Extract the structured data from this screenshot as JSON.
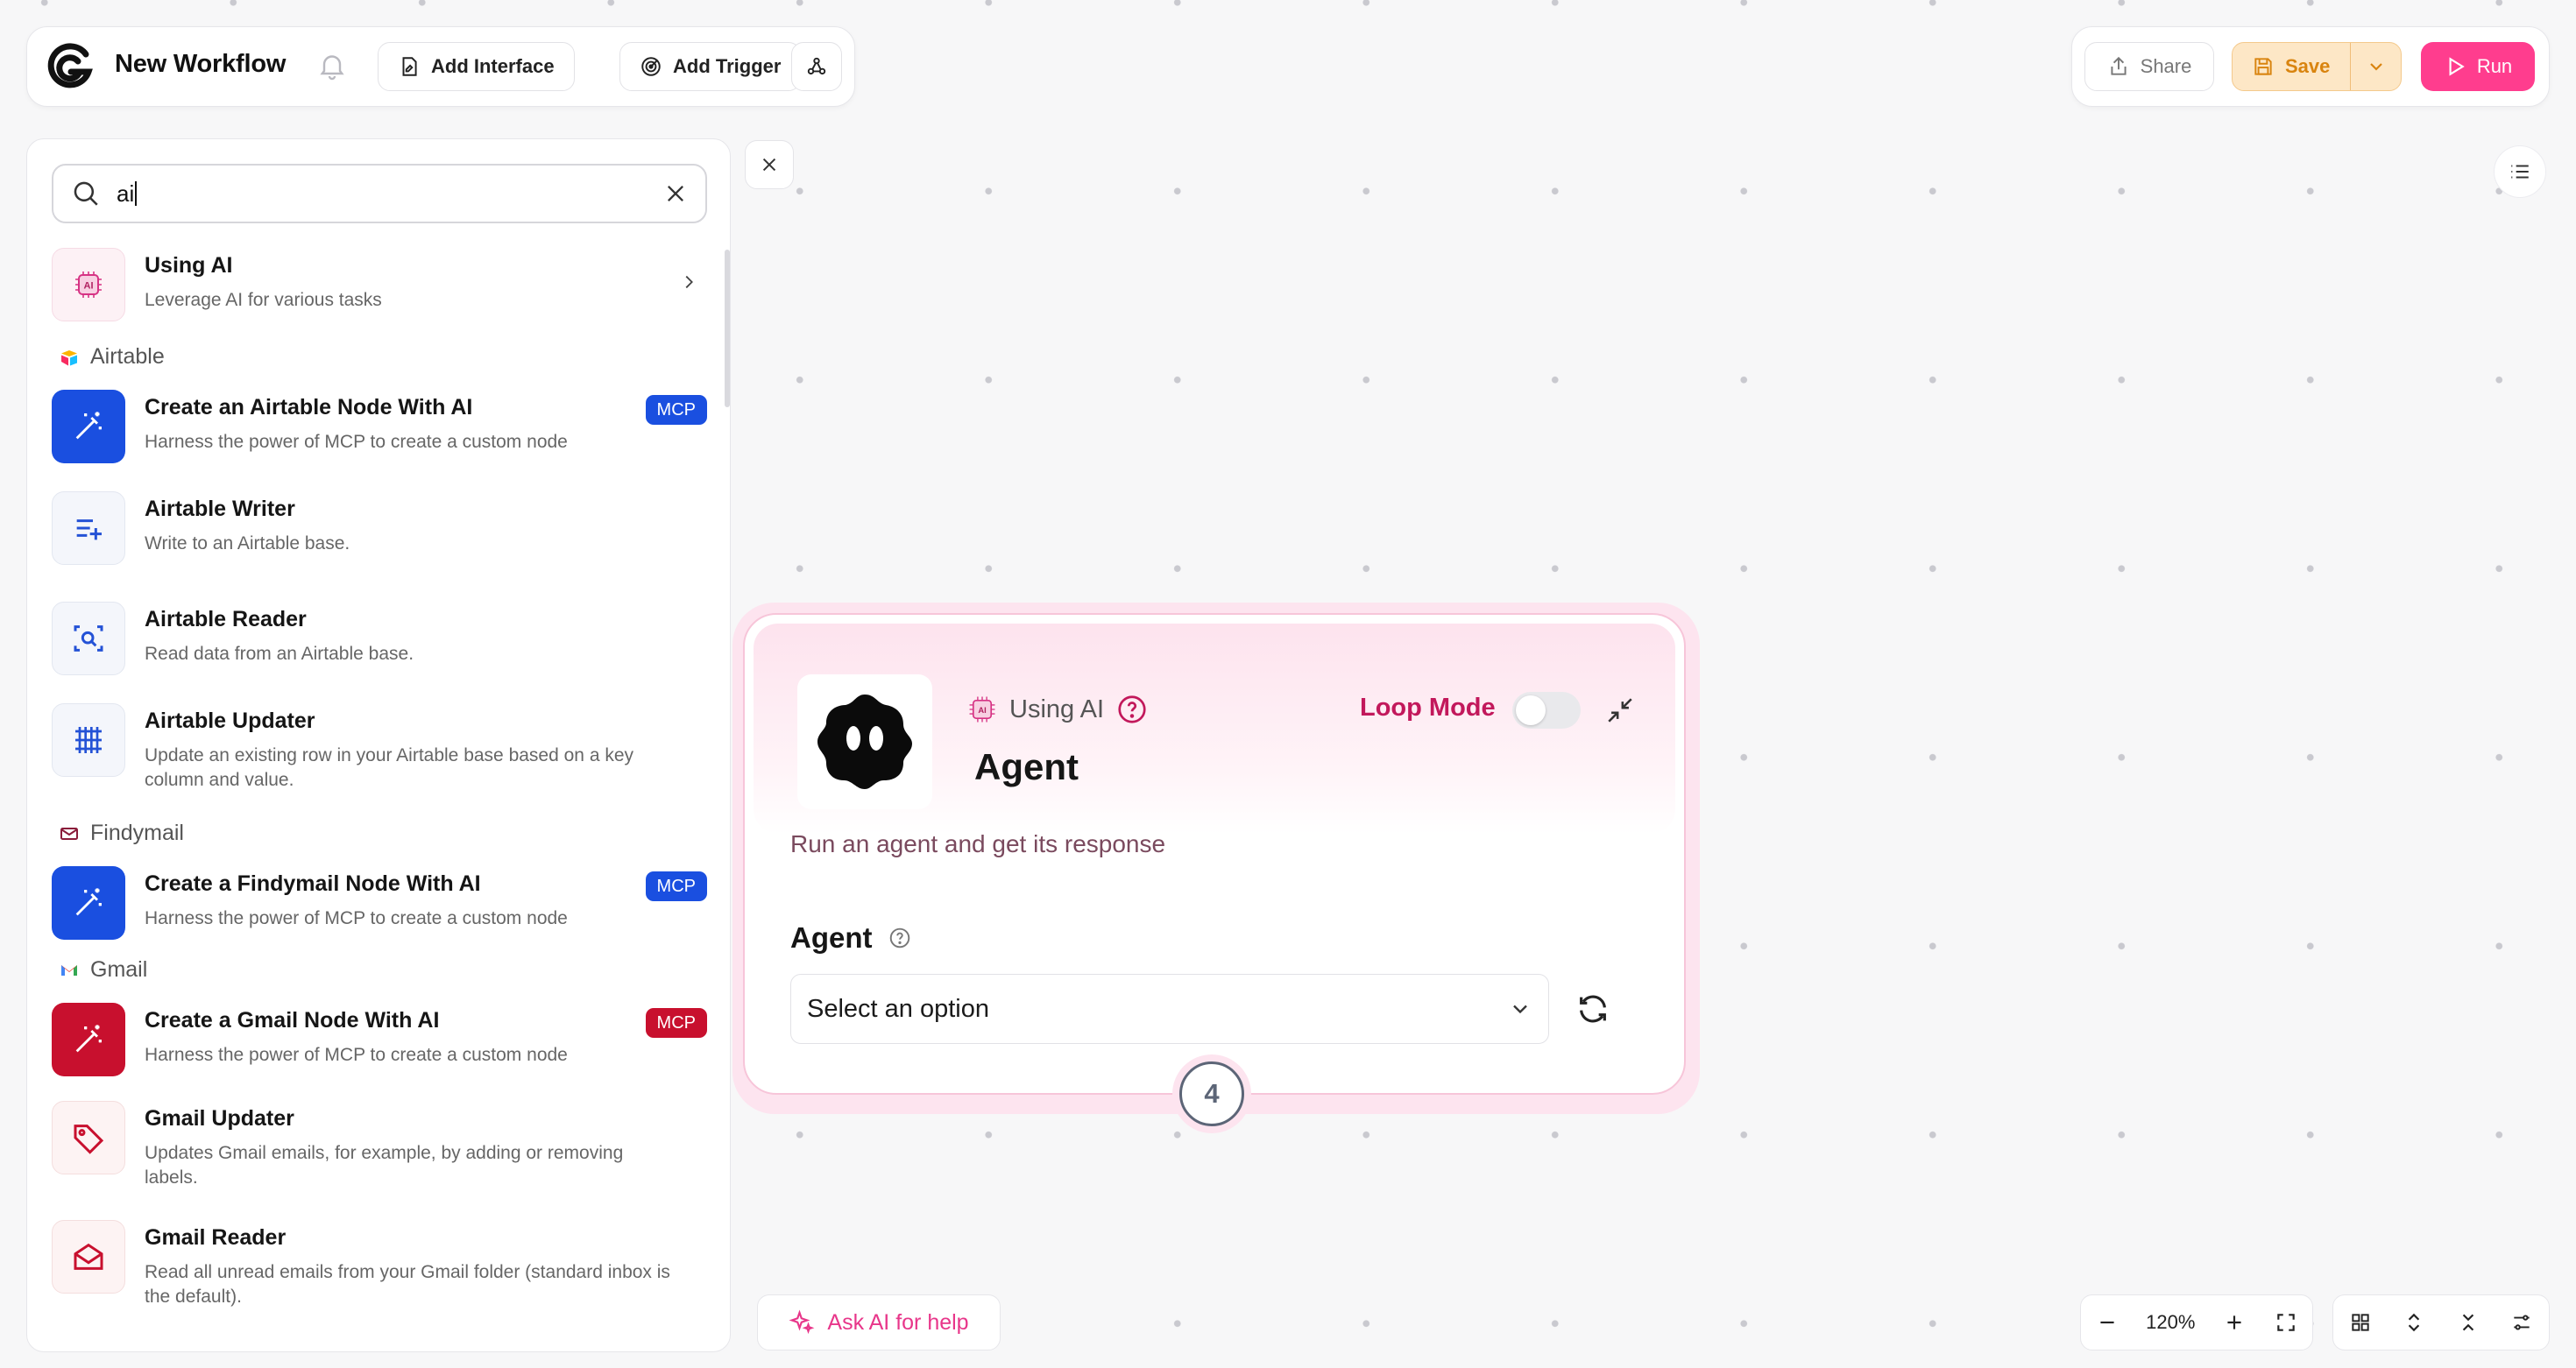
{
  "header": {
    "workflow_title": "New Workflow",
    "add_interface_label": "Add Interface",
    "add_trigger_label": "Add Trigger",
    "share_label": "Share",
    "save_label": "Save",
    "run_label": "Run"
  },
  "search": {
    "value": "ai"
  },
  "list": {
    "using_ai": {
      "title": "Using AI",
      "desc": "Leverage AI for various tasks"
    },
    "groups": {
      "airtable": "Airtable",
      "findymail": "Findymail",
      "gmail": "Gmail"
    },
    "items": [
      {
        "title": "Create an Airtable Node With AI",
        "desc": "Harness the power of MCP to create a custom node",
        "badge": "MCP"
      },
      {
        "title": "Airtable Writer",
        "desc": "Write to an Airtable base."
      },
      {
        "title": "Airtable Reader",
        "desc": "Read data from an Airtable base."
      },
      {
        "title": "Airtable Updater",
        "desc": "Update an existing row in your Airtable base based on a key column and value."
      },
      {
        "title": "Create a Findymail Node With AI",
        "desc": "Harness the power of MCP to create a custom node",
        "badge": "MCP"
      },
      {
        "title": "Create a Gmail Node With AI",
        "desc": "Harness the power of MCP to create a custom node",
        "badge": "MCP"
      },
      {
        "title": "Gmail Updater",
        "desc": "Updates Gmail emails, for example, by adding or removing labels."
      },
      {
        "title": "Gmail Reader",
        "desc": "Read all unread emails from your Gmail folder (standard inbox is the default)."
      }
    ]
  },
  "node": {
    "category": "Using AI",
    "title": "Agent",
    "loop_mode_label": "Loop Mode",
    "loop_mode_on": false,
    "description": "Run an agent and get its response",
    "field_label": "Agent",
    "select_placeholder": "Select an option",
    "step_number": "4"
  },
  "footer": {
    "ask_ai_label": "Ask AI for help",
    "zoom_level": "120%"
  },
  "colors": {
    "accent_pink": "#ff3d8e",
    "save_orange": "#d9840f",
    "mcp_blue": "#1a4fe0",
    "mcp_red": "#c8102e",
    "loop_mode": "#c2185b"
  }
}
